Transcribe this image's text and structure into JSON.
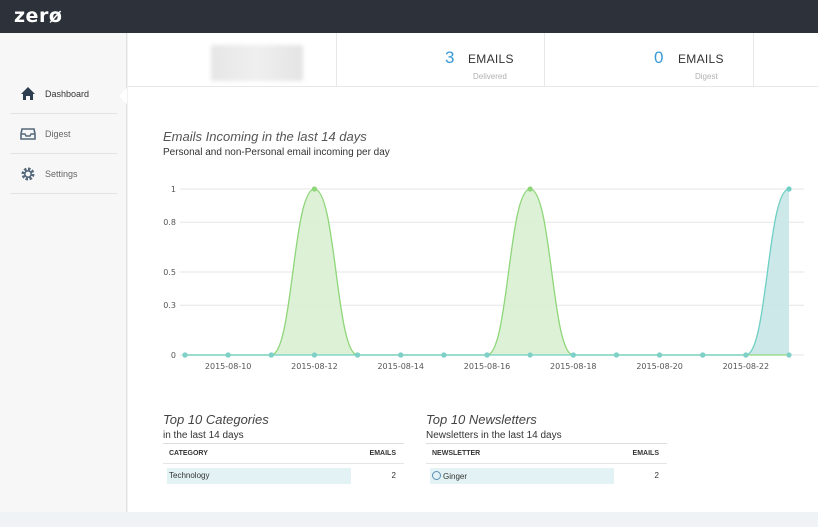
{
  "app": {
    "logo": "zerø"
  },
  "sidebar": {
    "items": [
      {
        "label": "Dashboard",
        "icon": "home-icon",
        "active": true
      },
      {
        "label": "Digest",
        "icon": "inbox-icon",
        "active": false
      },
      {
        "label": "Settings",
        "icon": "gear-icon",
        "active": false
      }
    ]
  },
  "stats": [
    {
      "value": "3",
      "label": "EMAILS",
      "sub": "Delivered"
    },
    {
      "value": "0",
      "label": "EMAILS",
      "sub": "Digest"
    }
  ],
  "chart_section": {
    "title": "Emails Incoming in the last 14 days",
    "subtitle": "Personal and non-Personal email incoming per day"
  },
  "chart_data": {
    "type": "area",
    "x": [
      "2015-08-09",
      "2015-08-10",
      "2015-08-11",
      "2015-08-12",
      "2015-08-13",
      "2015-08-14",
      "2015-08-15",
      "2015-08-16",
      "2015-08-17",
      "2015-08-18",
      "2015-08-19",
      "2015-08-20",
      "2015-08-21",
      "2015-08-22",
      "2015-08-23"
    ],
    "xtick_labels": [
      "2015-08-10",
      "2015-08-12",
      "2015-08-14",
      "2015-08-16",
      "2015-08-18",
      "2015-08-20",
      "2015-08-22"
    ],
    "ytick_labels": [
      "0",
      "0.3",
      "0.5",
      "0.8",
      "1"
    ],
    "ylim": [
      0,
      1
    ],
    "grid": true,
    "series": [
      {
        "values": [
          0,
          0,
          0,
          1,
          0,
          0,
          0,
          0,
          1,
          0,
          0,
          0,
          0,
          0,
          0
        ],
        "color": "#8fd67a",
        "fill": "#d9efd1"
      },
      {
        "values": [
          0,
          0,
          0,
          0,
          0,
          0,
          0,
          0,
          0,
          0,
          0,
          0,
          0,
          0,
          1
        ],
        "color": "#6fcfc4",
        "fill": "#c6e6e6"
      }
    ]
  },
  "categories": {
    "title": "Top 10 Categories",
    "subtitle": "in the last 14 days",
    "headers": [
      "CATEGORY",
      "EMAILS"
    ],
    "rows": [
      {
        "name": "Technology",
        "count": "2"
      }
    ]
  },
  "newsletters": {
    "title": "Top 10 Newsletters",
    "subtitle": "Newsletters in the last 14 days",
    "headers": [
      "NEWSLETTER",
      "EMAILS"
    ],
    "rows": [
      {
        "name": "Ginger",
        "count": "2"
      }
    ]
  }
}
